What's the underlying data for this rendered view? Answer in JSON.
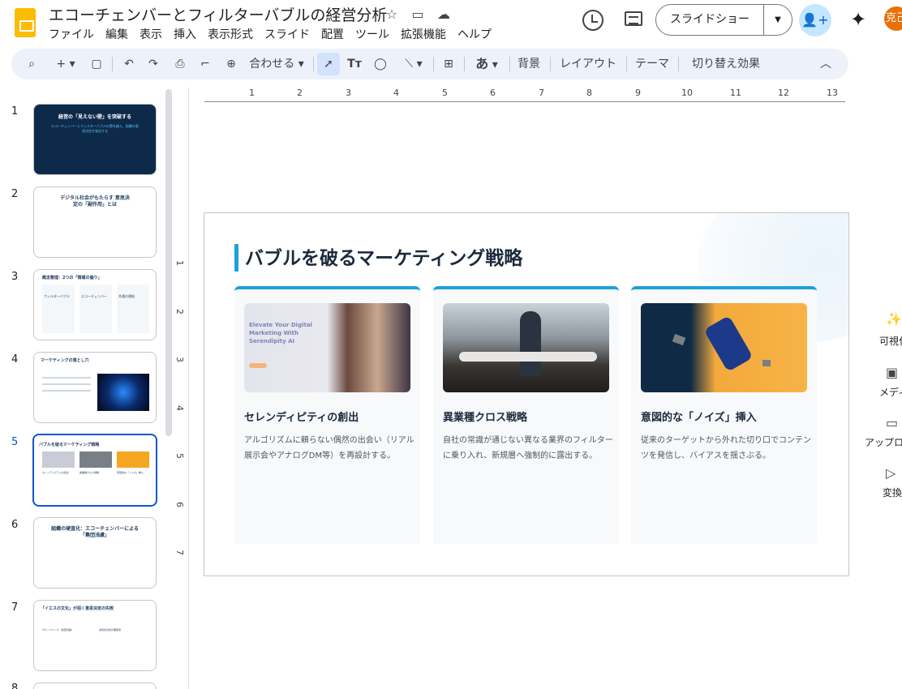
{
  "header": {
    "title": "エコーチェンバーとフィルターバブルの経営分析",
    "menu": [
      "ファイル",
      "編集",
      "表示",
      "挿入",
      "表示形式",
      "スライド",
      "配置",
      "ツール",
      "拡張機能",
      "ヘルプ"
    ],
    "slideshow_label": "スライドショー",
    "avatar_text": "克己"
  },
  "toolbar": {
    "zoom_label": "合わせる",
    "input_label": "あ",
    "background_label": "背景",
    "layout_label": "レイアウト",
    "theme_label": "テーマ",
    "transition_label": "切り替え効果"
  },
  "ruler": {
    "h": [
      "1",
      "2",
      "3",
      "4",
      "5",
      "6",
      "7",
      "8",
      "9",
      "10",
      "11",
      "12",
      "13"
    ],
    "v": [
      "1",
      "2",
      "3",
      "4",
      "5",
      "6",
      "7"
    ]
  },
  "filmstrip": {
    "slides": [
      {
        "num": "1",
        "title": "経営の「見えない壁」を突破する",
        "subtitle": "エコーチェンバーとフィルターバブルの罠を越え、組織の意思決定を強化する"
      },
      {
        "num": "2",
        "title": "デジタル社会がもたらす 意思決定の「副作用」とは"
      },
      {
        "num": "3",
        "title": "概念整理：2つの「情報の偏り」",
        "cols": [
          "フィルターバブル",
          "エコーチェンバー",
          "共通の帰結"
        ]
      },
      {
        "num": "4",
        "title": "マーケティングの落とし穴"
      },
      {
        "num": "5",
        "title": "バブルを破るマーケティング戦略",
        "cols": [
          "セレンディピティの創出",
          "異業種クロス戦略",
          "意図的な「ノイズ」挿入"
        ]
      },
      {
        "num": "6",
        "title": "組織の硬直化：エコーチェンバーによる「集団浅慮」"
      },
      {
        "num": "7",
        "title": "「イエスの文化」が招く意思決定の失敗",
        "cols": [
          "グループシンク（集団浅慮）",
          "多様性欠如の悪循環"
        ]
      },
      {
        "num": "8",
        "title": ""
      }
    ]
  },
  "slide": {
    "title": "バブルを破るマーケティング戦略",
    "cards": [
      {
        "heading": "セレンディピティの創出",
        "body": "アルゴリズムに頼らない偶然の出会い（リアル展示会やアナログDM等）を再設計する。",
        "image_text": "Elevate Your Digital Marketing With Serendipity AI"
      },
      {
        "heading": "異業種クロス戦略",
        "body": "自社の常識が通じない異なる業界のフィルターに乗り入れ、新規層へ強制的に露出する。"
      },
      {
        "heading": "意図的な「ノイズ」挿入",
        "body": "従来のターゲットから外れた切り口でコンテンツを発信し、バイアスを揺さぶる。"
      }
    ]
  },
  "right_panel": {
    "items": [
      {
        "label": "可視化",
        "icon": "sparkle-icon"
      },
      {
        "label": "メディア",
        "icon": "media-icon"
      },
      {
        "label": "アップロード",
        "icon": "folder-icon"
      },
      {
        "label": "変換",
        "icon": "convert-icon"
      }
    ]
  },
  "colors": {
    "accent": "#1da1d9",
    "selection": "#0b57d0",
    "title": "#1b2a3c",
    "brand": "#fbbc04"
  }
}
